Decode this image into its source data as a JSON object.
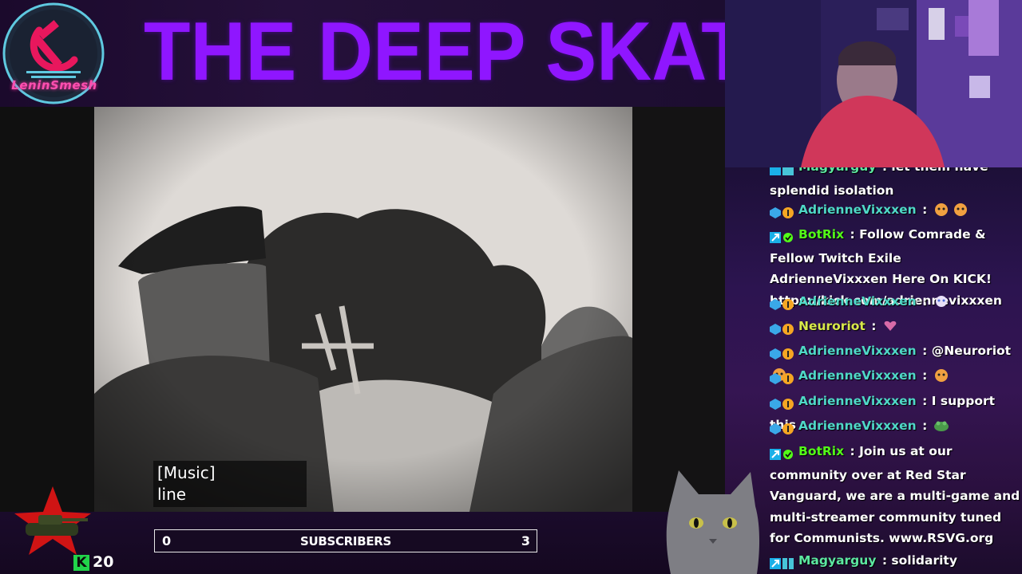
{
  "header": {
    "logo_text": "LeninSmesh",
    "title": "THE DEEP SKATE"
  },
  "video": {
    "captions": [
      "[Music]",
      "line"
    ]
  },
  "subscribers": {
    "current": "0",
    "label": "SUBSCRIBERS",
    "goal": "3"
  },
  "kick": {
    "badge": "K",
    "count": "20"
  },
  "colors": {
    "title": "#8f16ff",
    "adrienne": "#4fd8c7",
    "botrix": "#53fc18",
    "neuroriot": "#d8e84a",
    "magyarguy": "#5ce8a0"
  },
  "chat": {
    "messages": [
      {
        "user": "Magyarguy",
        "sep": " : ",
        "text": "let them have splendid isolation",
        "partial_top": true
      },
      {
        "user": "AdrienneVixxxen",
        "sep": " : ",
        "text": "",
        "emotes": [
          "cat-emote",
          "cat-emote"
        ]
      },
      {
        "user": "BotRix",
        "sep": " : ",
        "text": "Follow Comrade & Fellow Twitch Exile AdrienneVixxxen Here On KICK! https://kick.com/adriennevixxxen"
      },
      {
        "user": "AdrienneVixxxen",
        "sep": " : ",
        "text": "",
        "emotes": [
          "sad-emote"
        ]
      },
      {
        "user": "Neuroriot",
        "sep": " : ",
        "text": "",
        "emotes": [
          "heart-emote"
        ]
      },
      {
        "user": "AdrienneVixxxen",
        "sep": " : ",
        "text": "@Neuroriot",
        "emotes": [
          "cat-emote"
        ]
      },
      {
        "user": "AdrienneVixxxen",
        "sep": " : ",
        "text": "",
        "emotes": [
          "cat-emote"
        ]
      },
      {
        "user": "AdrienneVixxxen",
        "sep": " : ",
        "text": "I support this"
      },
      {
        "user": "AdrienneVixxxen",
        "sep": " : ",
        "text": "",
        "emotes": [
          "frog-emote"
        ]
      },
      {
        "user": "BotRix",
        "sep": " : ",
        "text": "Join us at our community over at Red Star Vanguard, we are a multi-game and multi-streamer community tuned for Communists. www.RSVG.org"
      },
      {
        "user": "Magyarguy",
        "sep": " : ",
        "text": "solidarity"
      }
    ]
  }
}
